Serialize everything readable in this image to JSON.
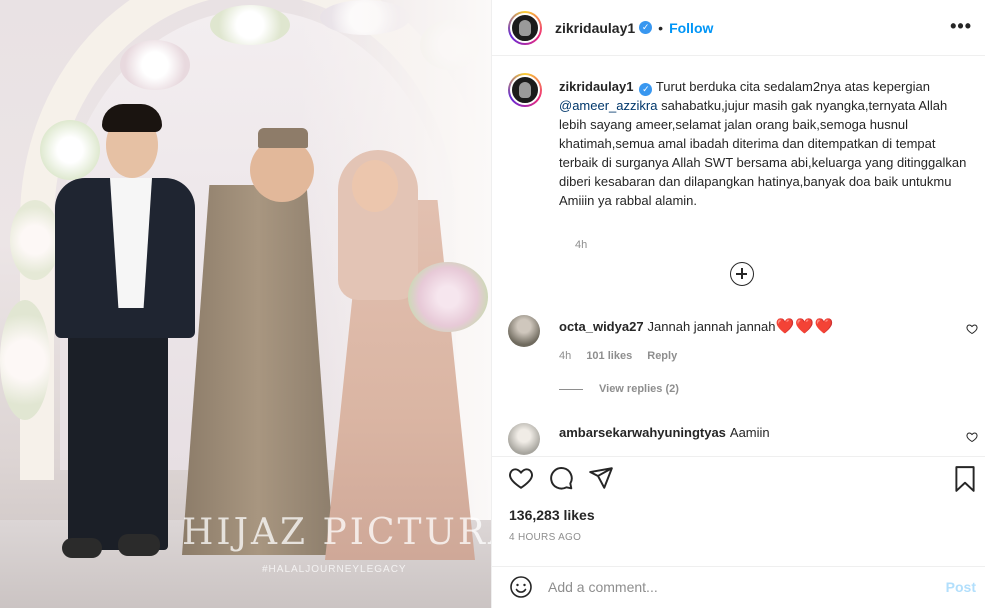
{
  "photo": {
    "watermark": "HIJAZ PICTURA",
    "watermark_tag": "#HALALJOURNEYLEGACY"
  },
  "header": {
    "username": "zikridaulay1",
    "verified_glyph": "✓",
    "separator": "•",
    "follow_label": "Follow",
    "more_label": "•••"
  },
  "caption": {
    "username": "zikridaulay1",
    "text_before_mention": "Turut berduka cita sedalam2nya atas kepergian",
    "mention": "@ameer_azzikra",
    "text_after_mention": "sahabatku,jujur masih gak nyangka,ternyata Allah lebih sayang ameer,selamat jalan orang baik,semoga husnul khatimah,semua amal ibadah diterima dan ditempatkan di tempat terbaik di surganya Allah SWT bersama abi,keluarga yang ditinggalkan diberi kesabaran dan dilapangkan hatinya,banyak doa baik untukmu Amiiin ya rabbal alamin.",
    "time": "4h"
  },
  "comments": [
    {
      "username": "octa_widya27",
      "text": "Jannah jannah jannah",
      "hearts": "❤️❤️❤️",
      "time": "4h",
      "likes": "101 likes",
      "reply_label": "Reply",
      "view_replies": "View replies (2)"
    },
    {
      "username": "ambarsekarwahyuningtyas",
      "text": "Aamiin"
    }
  ],
  "actions": {
    "likes": "136,283 likes",
    "time_ago": "4 HOURS AGO"
  },
  "add_comment": {
    "placeholder": "Add a comment...",
    "post_label": "Post"
  },
  "colors": {
    "link_blue": "#0095f6",
    "mention": "#00376b",
    "heart_red": "#ed4956",
    "post_disabled": "#b2dffc"
  }
}
